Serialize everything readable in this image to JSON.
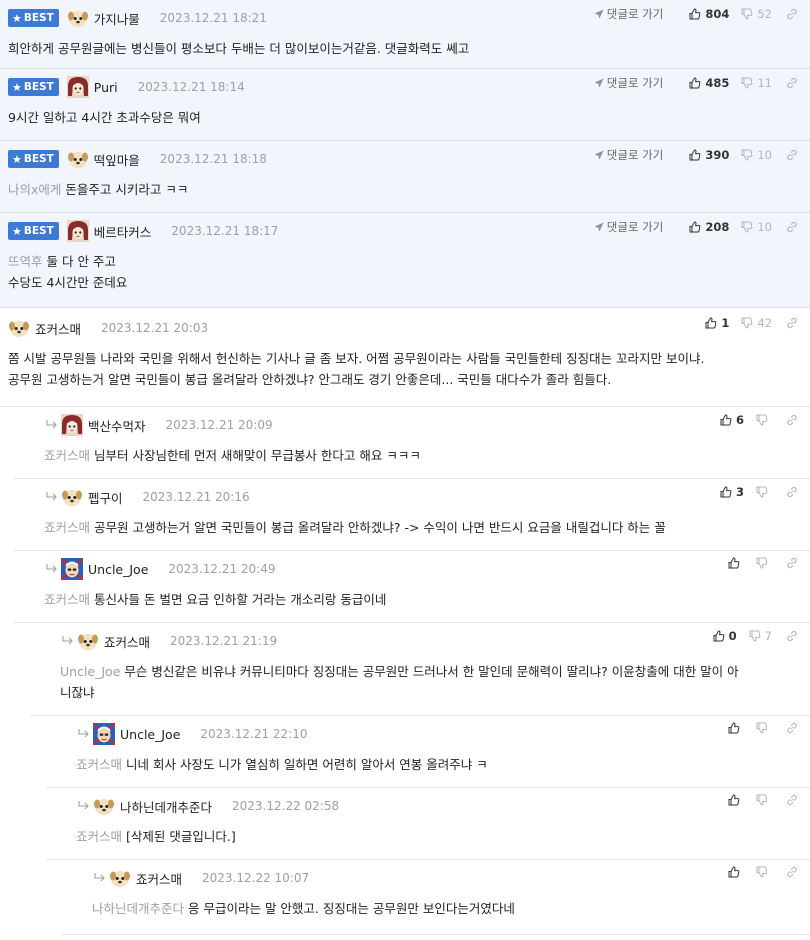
{
  "ui": {
    "best_label": "BEST",
    "goto_label": "댓글로 가기"
  },
  "best_comments": [
    {
      "nick": "가지나물",
      "date": "2023.12.21 18:21",
      "up": "804",
      "down": "52",
      "avatar": "dog",
      "target": "",
      "lines": [
        "희안하게 공무원글에는 병신들이 평소보다 두배는 더 많이보이는거같음. 댓글화력도 쎄고"
      ]
    },
    {
      "nick": "Puri",
      "date": "2023.12.21 18:14",
      "up": "485",
      "down": "11",
      "avatar": "doll",
      "target": "",
      "lines": [
        "9시간 일하고 4시간 초과수당은 뭐여"
      ]
    },
    {
      "nick": "떡잎마을",
      "date": "2023.12.21 18:18",
      "up": "390",
      "down": "10",
      "avatar": "dog",
      "target": "나의x에게",
      "lines": [
        "돈을주고 시키라고 ㅋㅋ"
      ]
    },
    {
      "nick": "베르타커스",
      "date": "2023.12.21 18:17",
      "up": "208",
      "down": "10",
      "avatar": "doll",
      "target": "뜨역후",
      "lines": [
        "둘 다 안 주고",
        "수당도 4시간만 준데요"
      ]
    }
  ],
  "comments": [
    {
      "nick": "죠커스매",
      "date": "2023.12.21 20:03",
      "up": "1",
      "down": "42",
      "avatar": "dog",
      "target": "",
      "lines": [
        "쫌 시발 공무원들 나라와 국민을 위해서 헌신하는 기사나 글 좀 보자. 어쩜 공무원이라는 사람들 국민들한테 징징대는 꼬라지만 보이냐.",
        "공무원 고생하는거 알면 국민들이 봉급 올려달라 안하겠냐? 안그래도 경기 안좋은데... 국민들 대다수가 졸라 힘들다."
      ]
    },
    {
      "nick": "백산수먹자",
      "date": "2023.12.21 20:09",
      "up": "6",
      "down": "",
      "avatar": "doll",
      "target": "죠커스매",
      "lines": [
        "님부터 사장님한테 먼저 새해맞이 무급봉사 한다고 해요 ㅋㅋㅋ"
      ]
    },
    {
      "nick": "펩구이",
      "date": "2023.12.21 20:16",
      "up": "3",
      "down": "",
      "avatar": "dog",
      "target": "죠커스매",
      "lines": [
        "공무원 고생하는거 알면 국민들이 봉급 올려달라 안하겠냐? -> 수익이 나면 반드시 요금을 내릴겁니다 하는 꼴"
      ]
    },
    {
      "nick": "Uncle_Joe",
      "date": "2023.12.21 20:49",
      "up": "",
      "down": "",
      "avatar": "joe",
      "target": "죠커스매",
      "lines": [
        "통신사들 돈 벌면 요금 인하할 거라는 개소리랑 동급이네"
      ]
    },
    {
      "nick": "죠커스매",
      "date": "2023.12.21 21:19",
      "up": "0",
      "down": "7",
      "avatar": "dog",
      "target": "Uncle_Joe",
      "lines": [
        "무슨 병신같은 비유냐 커뮤니티마다 징징대는 공무원만 드러나서 한 말인데 문해력이 딸리냐? 이윤창출에 대한 말이 아",
        "니잖냐"
      ]
    },
    {
      "nick": "Uncle_Joe",
      "date": "2023.12.21 22:10",
      "up": "",
      "down": "",
      "avatar": "joe",
      "target": "죠커스매",
      "lines": [
        "니네 회사 사장도 니가 열심히 일하면 어련히 알아서 연봉 올려주냐 ㅋ"
      ]
    },
    {
      "nick": "나하닌데개추준다",
      "date": "2023.12.22 02:58",
      "up": "",
      "down": "",
      "avatar": "dog",
      "target": "죠커스매",
      "lines": [
        "[삭제된 댓글입니다.]"
      ]
    },
    {
      "nick": "죠커스매",
      "date": "2023.12.22 10:07",
      "up": "",
      "down": "",
      "avatar": "dog",
      "target": "나하닌데개추준다",
      "lines": [
        "응 무급이라는 말 안했고. 징징대는 공무원만 보인다는거였다네"
      ]
    }
  ]
}
